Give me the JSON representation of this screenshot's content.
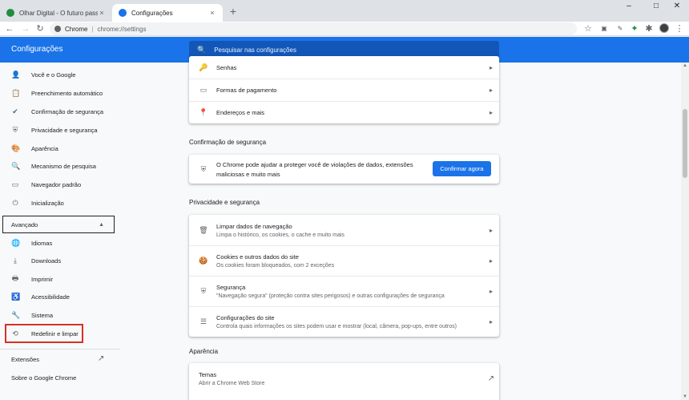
{
  "tabs": [
    {
      "title": "Olhar Digital - O futuro passa pri",
      "close": "×",
      "favicon_color": "#1e8e3e"
    },
    {
      "title": "Configurações",
      "close": "×",
      "favicon_color": "#1a73e8"
    }
  ],
  "new_tab": "+",
  "window": {
    "minimize": "–",
    "maximize": "□",
    "close": "✕"
  },
  "toolbar": {
    "back": "←",
    "forward": "→",
    "reload": "↻",
    "site_label": "Chrome",
    "separator": "|",
    "url": "chrome://settings",
    "star": "☆",
    "menu": "⋮"
  },
  "header": {
    "title": "Configurações",
    "search_placeholder": "Pesquisar nas configurações",
    "search_icon": "🔍"
  },
  "sidebar": {
    "items": [
      {
        "label": "Você e o Google",
        "icon": "person-icon",
        "glyph": "👤"
      },
      {
        "label": "Preenchimento automático",
        "icon": "clipboard-icon",
        "glyph": "📋"
      },
      {
        "label": "Confirmação de segurança",
        "icon": "shield-check-icon",
        "glyph": "✔"
      },
      {
        "label": "Privacidade e segurança",
        "icon": "shield-icon",
        "glyph": "⛨"
      },
      {
        "label": "Aparência",
        "icon": "palette-icon",
        "glyph": "🎨"
      },
      {
        "label": "Mecanismo de pesquisa",
        "icon": "search-icon",
        "glyph": "🔍"
      },
      {
        "label": "Navegador padrão",
        "icon": "browser-icon",
        "glyph": "▭"
      },
      {
        "label": "Inicialização",
        "icon": "power-icon",
        "glyph": "⏻"
      }
    ],
    "advanced_label": "Avançado",
    "advanced_caret": "▲",
    "advanced_items": [
      {
        "label": "Idiomas",
        "icon": "globe-icon",
        "glyph": "🌐"
      },
      {
        "label": "Downloads",
        "icon": "download-icon",
        "glyph": "⤓"
      },
      {
        "label": "Imprimir",
        "icon": "printer-icon",
        "glyph": "🖶"
      },
      {
        "label": "Acessibilidade",
        "icon": "accessibility-icon",
        "glyph": "♿"
      },
      {
        "label": "Sistema",
        "icon": "wrench-icon",
        "glyph": "🔧"
      },
      {
        "label": "Redefinir e limpar",
        "icon": "history-icon",
        "glyph": "⟲"
      }
    ],
    "extensions_label": "Extensões",
    "extensions_icon": "↗",
    "about_label": "Sobre o Google Chrome"
  },
  "autofill_card": [
    {
      "label": "Senhas",
      "icon": "key-icon",
      "glyph": "🔑"
    },
    {
      "label": "Formas de pagamento",
      "icon": "credit-card-icon",
      "glyph": "▭"
    },
    {
      "label": "Endereços e mais",
      "icon": "location-icon",
      "glyph": "📍"
    }
  ],
  "safety_check": {
    "heading": "Confirmação de segurança",
    "text_line1": "O Chrome pode ajudar a proteger você de violações de dados, extensões",
    "text_line2": "maliciosas e muito mais",
    "button": "Confirmar agora",
    "glyph": "⛨"
  },
  "privacy": {
    "heading": "Privacidade e segurança",
    "rows": [
      {
        "title": "Limpar dados de navegação",
        "subtitle": "Limpa o histórico, os cookies, o cache e muito mais",
        "icon": "trash-icon",
        "glyph": "🗑"
      },
      {
        "title": "Cookies e outros dados do site",
        "subtitle": "Os cookies foram bloqueados, com 2 exceções",
        "icon": "cookie-icon",
        "glyph": "🍪"
      },
      {
        "title": "Segurança",
        "subtitle": "\"Navegação segura\" (proteção contra sites perigosos) e outras configurações de segurança",
        "icon": "shield-icon",
        "glyph": "⛨"
      },
      {
        "title": "Configurações do site",
        "subtitle": "Controla quais informações os sites podem usar e mostrar (local, câmera, pop-ups, entre outros)",
        "icon": "sliders-icon",
        "glyph": "☰"
      }
    ]
  },
  "appearance": {
    "heading": "Aparência",
    "row_title": "Temas",
    "row_subtitle": "Abrir a Chrome Web Store",
    "external_glyph": "↗"
  },
  "arrow": "▸",
  "colors": {
    "accent": "#1a73e8",
    "highlight_box": "#d93025"
  }
}
